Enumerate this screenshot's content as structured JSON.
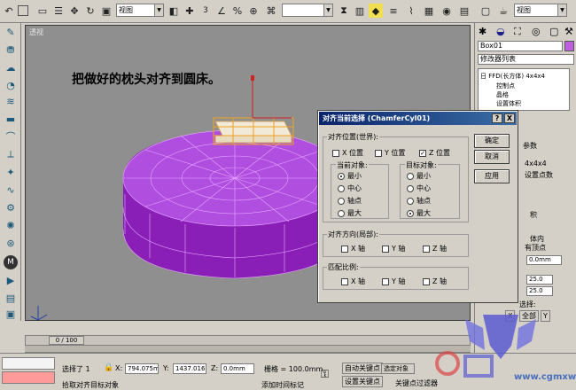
{
  "toolbar": {
    "view_select": "视图",
    "snap_label": "3"
  },
  "viewport": {
    "label": "透视",
    "note": "把做好的枕头对齐到圆床。"
  },
  "timeline": {
    "frame_readout": "0 / 100"
  },
  "status": {
    "selection": "选择了 1",
    "x_label": "X:",
    "x_value": "794.075m",
    "y_label": "Y:",
    "y_value": "1437.016r",
    "z_label": "Z:",
    "z_value": "0.0mm",
    "grid": "栅格 = 100.0mm",
    "auto_key": "自动关键点",
    "set_key": "设置关键点",
    "selected_object": "选定对象",
    "key_filters": "关键点过滤器",
    "prompt": "拾取对齐目标对象",
    "add_time_tag": "添加时间标记"
  },
  "command_panel": {
    "object_name": "Box01",
    "object_color": "#c060e0",
    "modifier_list": "修改器列表",
    "stack_items": [
      "日 FFD(长方体) 4x4x4",
      "控制点",
      "晶格",
      "设置体积"
    ],
    "params_heading": "参数",
    "lattice_size": "4x4x4",
    "set_points": "设置点数",
    "volume": "积",
    "inside_all": "体内",
    "all_vertices": "有顶点",
    "field1": "0.0mm",
    "field2": "25.0",
    "field3": "25.0",
    "select_heading": "选择:",
    "all_x": "X",
    "all_label": "全部",
    "all_y": "Y"
  },
  "dialog": {
    "title": "对齐当前选择 (ChamferCyl01)",
    "help_btn": "?",
    "close_btn": "X",
    "align_position_group": "对齐位置(世界):",
    "x_pos": "X 位置",
    "y_pos": "Y 位置",
    "z_pos": "Z 位置",
    "current_object_group": "当前对象:",
    "target_object_group": "目标对象:",
    "options": [
      "最小",
      "中心",
      "轴点",
      "最大"
    ],
    "align_orientation_group": "对齐方向(局部):",
    "x_axis": "X 轴",
    "y_axis": "Y 轴",
    "z_axis": "Z 轴",
    "match_scale_group": "匹配比例:",
    "ok_btn": "确定",
    "cancel_btn": "取消",
    "apply_btn": "应用"
  },
  "watermark": {
    "site": "www.cgmxw.com"
  }
}
